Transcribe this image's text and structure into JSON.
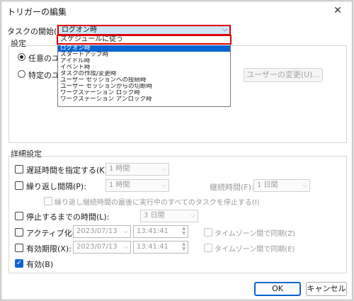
{
  "window": {
    "title": "トリガーの編集",
    "close_glyph": "✕"
  },
  "trigger": {
    "label": "タスクの開始(G):",
    "selected": "ログオン時",
    "options": [
      "スケジュールに従う",
      "ログオン時",
      "スタートアップ時",
      "アイドル時",
      "イベント時",
      "タスクの作成/変更時",
      "ユーザー セッションへの接続時",
      "ユーザー セッションからの切断時",
      "ワークステーション ロック時",
      "ワークステーション アンロック時"
    ]
  },
  "settings": {
    "label": "設定",
    "radio_any_user": "任意のユー",
    "radio_specific_user": "特定のユー",
    "change_user_button": "ユーザーの変更(U)..."
  },
  "advanced": {
    "label": "詳細設定",
    "delay_label": "遅延時間を指定する(K):",
    "delay_value": "1 時間",
    "repeat_label": "繰り返し間隔(P):",
    "repeat_value": "1 時間",
    "duration_label": "継続時間(F):",
    "duration_value": "1 日間",
    "stop_all_label": "繰り返し継続時間の最後に実行中のすべてのタスクを停止する(I)",
    "stop_after_label": "停止するまでの時間(L):",
    "stop_after_value": "3 日間",
    "activate_label": "アクティブ化(A):",
    "activate_date": "2023/07/13",
    "activate_time": "13:41:41",
    "activate_tz": "タイムゾーン間で同期(Z)",
    "expire_label": "有効期限(X):",
    "expire_date": "2023/07/13",
    "expire_time": "13:41:41",
    "expire_tz": "タイムゾーン間で同期(E)",
    "enabled_label": "有効(B)"
  },
  "buttons": {
    "ok": "OK",
    "cancel": "キャンセル"
  },
  "icons": {
    "dropdown_arrow": "chevron-down-icon",
    "spin": "spinner-icon",
    "check": "check-icon"
  },
  "colors": {
    "accent": "#0a64d0",
    "highlight_border": "#e00000"
  }
}
